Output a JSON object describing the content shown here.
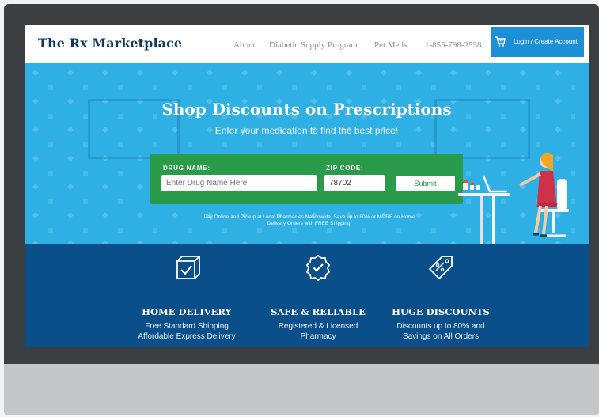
{
  "header": {
    "logo": "The Rx Marketplace",
    "nav": [
      "About",
      "Diabetic Supply Program",
      "Pet Meds",
      "1-855-798-2538"
    ],
    "login_label": "Login / Create Account"
  },
  "hero": {
    "title": "Shop Discounts on Prescriptions",
    "subtitle": "Enter your medication to find the best price!",
    "drug_label": "DRUG NAME:",
    "drug_placeholder": "Enter Drug Name Here",
    "zip_label": "ZIP CODE:",
    "zip_value": "78702",
    "submit_label": "Submit",
    "promo_line1": "Pay Online and Pickup at Local Pharmacies Nationwide, Save up to 80% or MORE on Home",
    "promo_line2": "Delivery Orders with FREE Shipping!"
  },
  "features": [
    {
      "title": "HOME DELIVERY",
      "line1": "Free Standard Shipping",
      "line2": "Affordable Express Delivery",
      "icon": "box-check-icon"
    },
    {
      "title": "SAFE & RELIABLE",
      "line1": "Registered & Licensed",
      "line2": "Pharmacy",
      "icon": "badge-check-icon"
    },
    {
      "title": "HUGE DISCOUNTS",
      "line1": "Discounts up to 80% and",
      "line2": "Savings on All Orders",
      "icon": "price-tag-icon"
    }
  ],
  "colors": {
    "hero_blue": "#2eb0e4",
    "search_green": "#2a9a4b",
    "features_navy": "#0a4f8a",
    "login_blue": "#1c8fd6",
    "logo_navy": "#0e3a5c"
  }
}
